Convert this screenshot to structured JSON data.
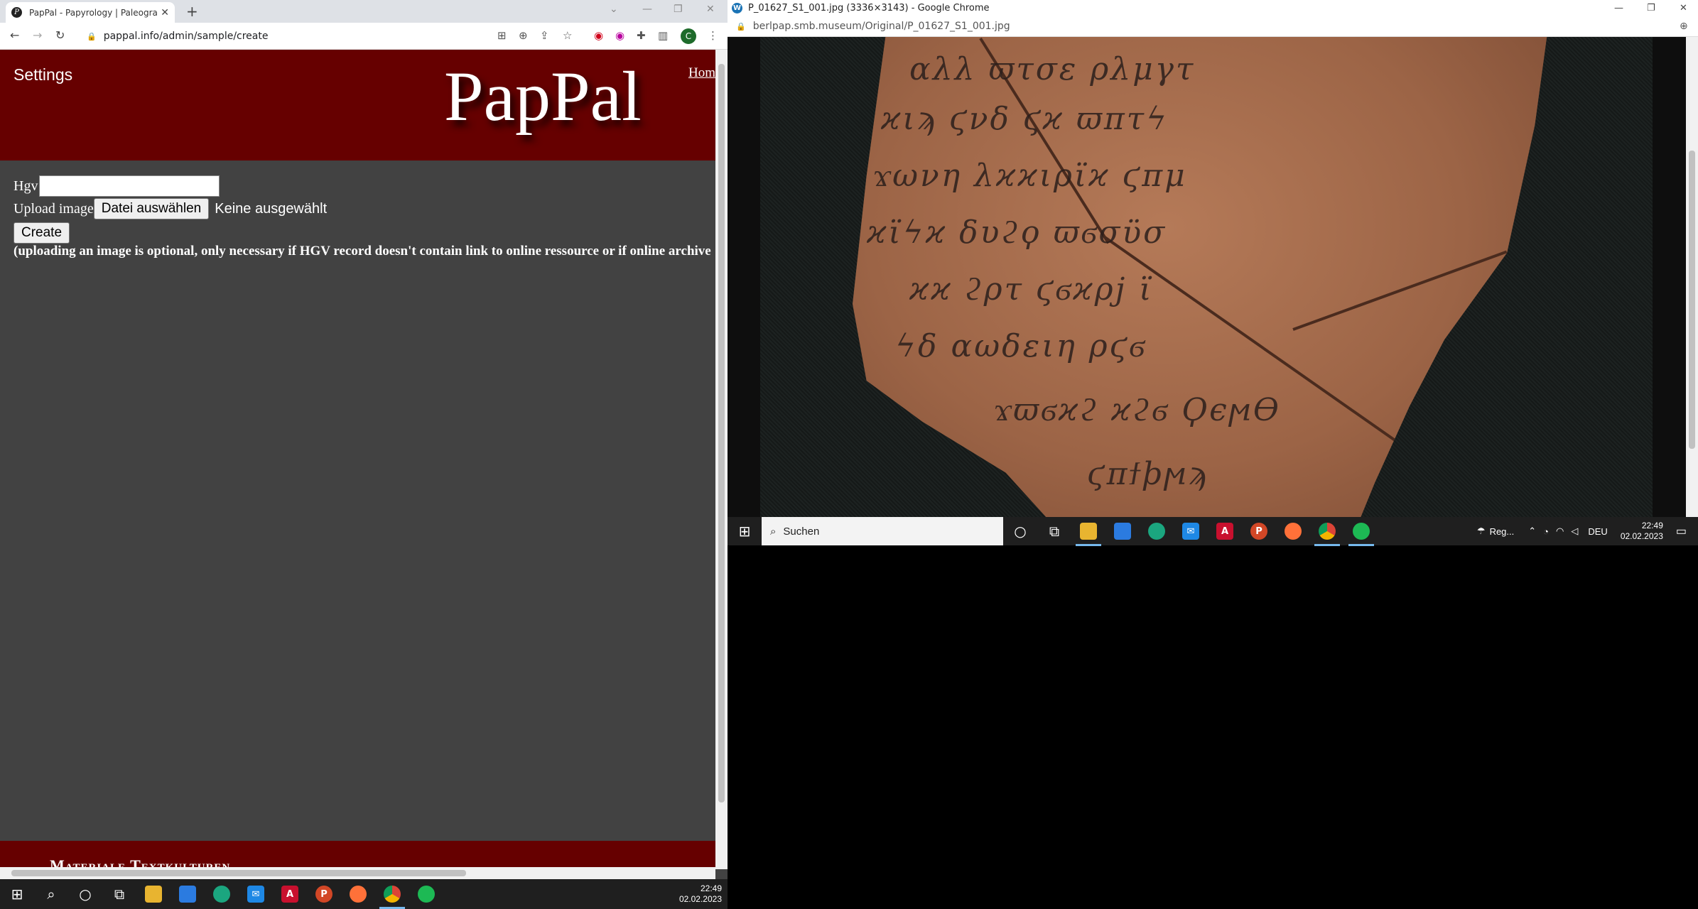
{
  "left_browser": {
    "tab_title": "PapPal - Papyrology | Paleography",
    "tab_favicon": "P",
    "url": "pappal.info/admin/sample/create",
    "profile_initial": "C"
  },
  "page": {
    "settings_label": "Settings",
    "logo": "PapPal",
    "home_link": "Home",
    "hgv_label": "Hgv",
    "upload_label": "Upload image",
    "file_button": "Datei auswählen",
    "no_file": "Keine ausgewählt",
    "create_button": "Create",
    "note": "(uploading an image is optional, only necessary if HGV record doesn't contain link to online ressource or if online archive",
    "footer_text": "Materiale Textkulturen"
  },
  "left_taskbar": {
    "time": "22:49",
    "date": "02.02.2023"
  },
  "right_browser": {
    "title": "P_01627_S1_001.jpg (3336×3143) - Google Chrome",
    "url": "berlpap.smb.museum/Original/P_01627_S1_001.jpg"
  },
  "right_taskbar": {
    "search_label": "Suchen",
    "weather": "Reg...",
    "lang": "DEU",
    "time": "22:49",
    "date": "02.02.2023"
  },
  "colors": {
    "header_red": "#660000",
    "page_bg": "#424242"
  }
}
